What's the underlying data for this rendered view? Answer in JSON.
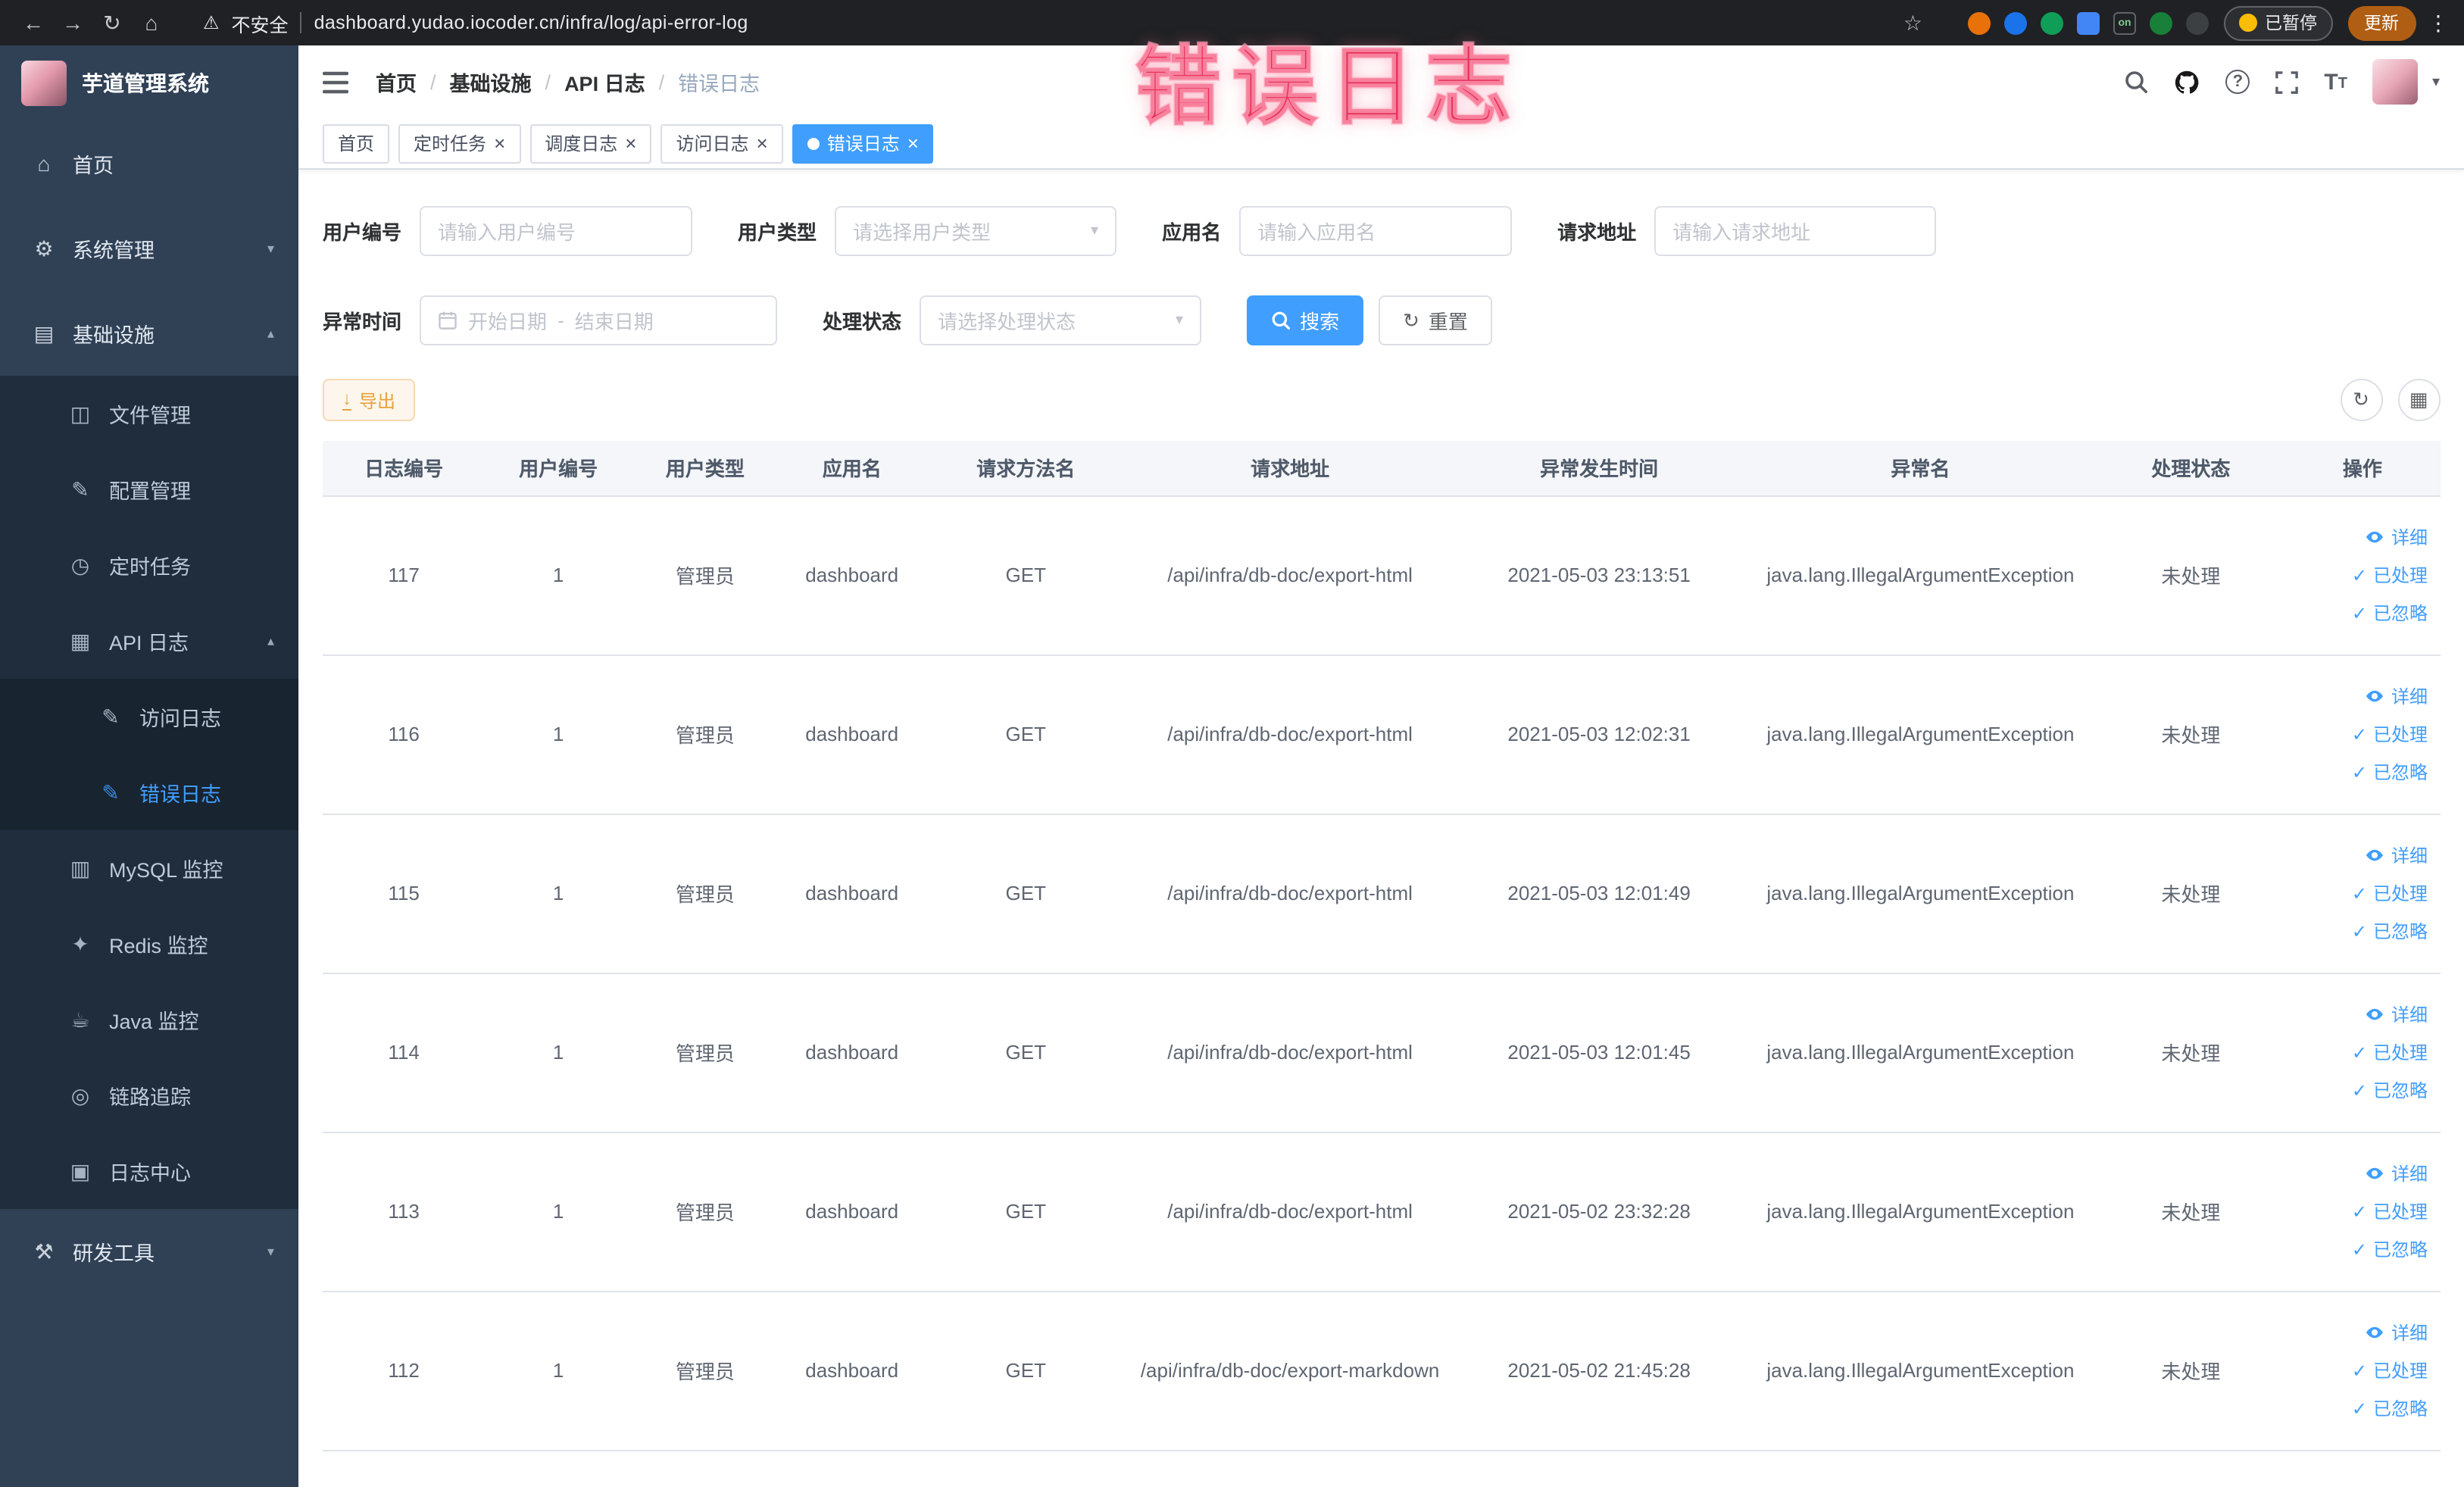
{
  "browser": {
    "security_label": "不安全",
    "url": "dashboard.yudao.iocoder.cn/infra/log/api-error-log",
    "extension_on_badge": "on",
    "paused_badge": "已暂停",
    "update_label": "更新"
  },
  "icons": {
    "back": "←",
    "forward": "→",
    "reload": "↻",
    "home_browser": "⌂",
    "warning": "⚠",
    "star": "☆",
    "more": "⋮",
    "home": "⌂",
    "gear": "⚙",
    "infra": "▤",
    "file": "◫",
    "config": "✎",
    "timer": "◷",
    "api_log": "▦",
    "access_log": "✎",
    "error_log": "✎",
    "mysql": "▥",
    "redis": "✦",
    "java": "☕",
    "trace": "◎",
    "log_center": "▣",
    "devtools": "⚒",
    "chevron_down": "▾",
    "chevron_up": "▴",
    "select_arrow": "▾",
    "caret_down": "▾",
    "close": "×",
    "check": "✓",
    "refresh": "↻",
    "grid": "▦",
    "download": "↓",
    "question": "?",
    "font_size": "T",
    "dot": "•"
  },
  "sidebar": {
    "logo_title": "芋道管理系统",
    "items": [
      {
        "label": "首页"
      },
      {
        "label": "系统管理"
      },
      {
        "label": "基础设施"
      },
      {
        "label": "文件管理"
      },
      {
        "label": "配置管理"
      },
      {
        "label": "定时任务"
      },
      {
        "label": "API 日志"
      },
      {
        "label": "访问日志"
      },
      {
        "label": "错误日志"
      },
      {
        "label": "MySQL 监控"
      },
      {
        "label": "Redis 监控"
      },
      {
        "label": "Java 监控"
      },
      {
        "label": "链路追踪"
      },
      {
        "label": "日志中心"
      },
      {
        "label": "研发工具"
      }
    ]
  },
  "breadcrumb": {
    "separator": "/",
    "items": [
      "首页",
      "基础设施",
      "API 日志",
      "错误日志"
    ]
  },
  "annotation": {
    "watermark_text": "错误日志"
  },
  "tabs": [
    {
      "label": "首页"
    },
    {
      "label": "定时任务"
    },
    {
      "label": "调度日志"
    },
    {
      "label": "访问日志"
    },
    {
      "label": "错误日志"
    }
  ],
  "filters": {
    "user_id": {
      "label": "用户编号",
      "placeholder": "请输入用户编号"
    },
    "user_type": {
      "label": "用户类型",
      "placeholder": "请选择用户类型"
    },
    "app_name": {
      "label": "应用名",
      "placeholder": "请输入应用名"
    },
    "request_url": {
      "label": "请求地址",
      "placeholder": "请输入请求地址"
    },
    "exception_time": {
      "label": "异常时间",
      "start_placeholder": "开始日期",
      "separator": "-",
      "end_placeholder": "结束日期"
    },
    "process_status": {
      "label": "处理状态",
      "placeholder": "请选择处理状态"
    },
    "search_label": "搜索",
    "reset_label": "重置"
  },
  "toolbar": {
    "export_label": "导出"
  },
  "table": {
    "columns": [
      "日志编号",
      "用户编号",
      "用户类型",
      "应用名",
      "请求方法名",
      "请求地址",
      "异常发生时间",
      "异常名",
      "处理状态",
      "操作"
    ],
    "actions": {
      "detail": "详细",
      "processed": "已处理",
      "ignored": "已忽略"
    },
    "rows": [
      {
        "log_id": "117",
        "user_id": "1",
        "user_type": "管理员",
        "app_name": "dashboard",
        "method": "GET",
        "url": "/api/infra/db-doc/export-html",
        "time": "2021-05-03 23:13:51",
        "exception": "java.lang.IllegalArgumentException",
        "status": "未处理"
      },
      {
        "log_id": "116",
        "user_id": "1",
        "user_type": "管理员",
        "app_name": "dashboard",
        "method": "GET",
        "url": "/api/infra/db-doc/export-html",
        "time": "2021-05-03 12:02:31",
        "exception": "java.lang.IllegalArgumentException",
        "status": "未处理"
      },
      {
        "log_id": "115",
        "user_id": "1",
        "user_type": "管理员",
        "app_name": "dashboard",
        "method": "GET",
        "url": "/api/infra/db-doc/export-html",
        "time": "2021-05-03 12:01:49",
        "exception": "java.lang.IllegalArgumentException",
        "status": "未处理"
      },
      {
        "log_id": "114",
        "user_id": "1",
        "user_type": "管理员",
        "app_name": "dashboard",
        "method": "GET",
        "url": "/api/infra/db-doc/export-html",
        "time": "2021-05-03 12:01:45",
        "exception": "java.lang.IllegalArgumentException",
        "status": "未处理"
      },
      {
        "log_id": "113",
        "user_id": "1",
        "user_type": "管理员",
        "app_name": "dashboard",
        "method": "GET",
        "url": "/api/infra/db-doc/export-html",
        "time": "2021-05-02 23:32:28",
        "exception": "java.lang.IllegalArgumentException",
        "status": "未处理"
      },
      {
        "log_id": "112",
        "user_id": "1",
        "user_type": "管理员",
        "app_name": "dashboard",
        "method": "GET",
        "url": "/api/infra/db-doc/export-markdown",
        "time": "2021-05-02 21:45:28",
        "exception": "java.lang.IllegalArgumentException",
        "status": "未处理"
      }
    ]
  },
  "colors": {
    "primary": "#409eff",
    "warning": "#e6a23c",
    "sidebar_bg": "#304156",
    "sidebar_submenu_bg": "#1f2d3d",
    "watermark_red": "#e8345e",
    "tag_active_bg": "#409eff"
  }
}
